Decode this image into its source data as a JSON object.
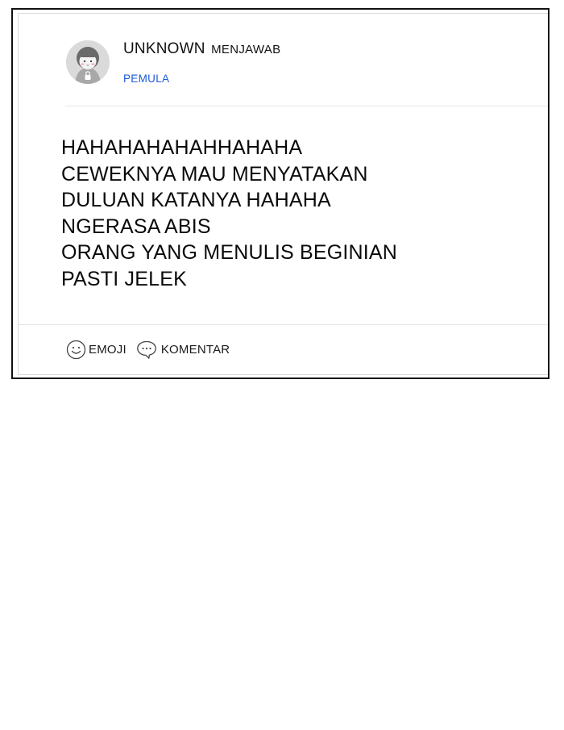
{
  "answer_card": {
    "author": {
      "name": "UNKNOWN",
      "action": "MENJAWAB",
      "rank": "PEMULA",
      "avatar_icon": "anonymous-user-icon"
    },
    "body_lines": [
      "HAHAHAHAHAHHAHAHA",
      "CEWEKNYA MAU MENYATAKAN",
      "DULUAN KATANYA HAHAHA",
      "NGERASA ABIS",
      "ORANG YANG MENULIS BEGINIAN",
      "PASTI JELEK"
    ],
    "actions": {
      "emoji_label": "EMOJI",
      "emoji_icon": "smiley-icon",
      "comment_label": "KOMENTAR",
      "comment_icon": "speech-bubble-icon"
    }
  },
  "colors": {
    "rank": "#1a58d6",
    "panel_border": "#111111",
    "divider": "#e6e6e6",
    "text": "#0a0a0a"
  }
}
